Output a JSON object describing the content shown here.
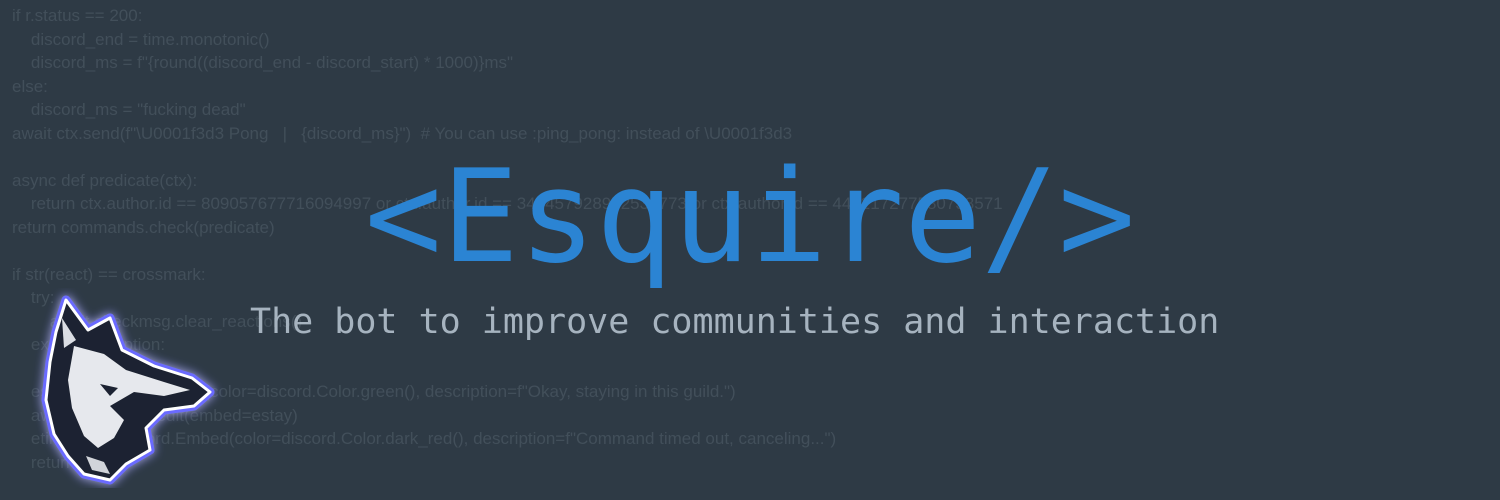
{
  "background_code": [
    "if r.status == 200:",
    "    discord_end = time.monotonic()",
    "    discord_ms = f\"{round((discord_end - discord_start) * 1000)}ms\"",
    "else:",
    "    discord_ms = \"fucking dead\"",
    "await ctx.send(f\"\\U0001f3d3 Pong   |   {discord_ms}\")  # You can use :ping_pong: instead of \\U0001f3d3",
    "",
    "async def predicate(ctx):",
    "    return ctx.author.id == 809057677716094997 or ctx.author.id == 345457928972533773 or ctx.author.id == 443217277580738571",
    "return commands.check(predicate)",
    "",
    "if str(react) == crossmark:",
    "    try:",
    "        await checkmsg.clear_reactions()",
    "    except Exception:",
    "        pass",
    "    estay = discord.Embed(color=discord.Color.green(), description=f\"Okay, staying in this guild.\")",
    "    await checkmsg.edit(embed=estay)",
    "    etimeout = discord.Embed(color=discord.Color.dark_red(), description=f\"Command timed out, canceling...\")",
    "    return"
  ],
  "title": "<Esquire/>",
  "subtitle": "The bot to improve communities and interaction",
  "logo": {
    "icon": "wolf-head-icon",
    "outline_color": "#ffffff",
    "glow_color": "#5b5bff"
  },
  "colors": {
    "background": "#2e3a45",
    "code": "#424f5a",
    "title": "#2b84d3",
    "subtitle": "#a6b3bf"
  }
}
